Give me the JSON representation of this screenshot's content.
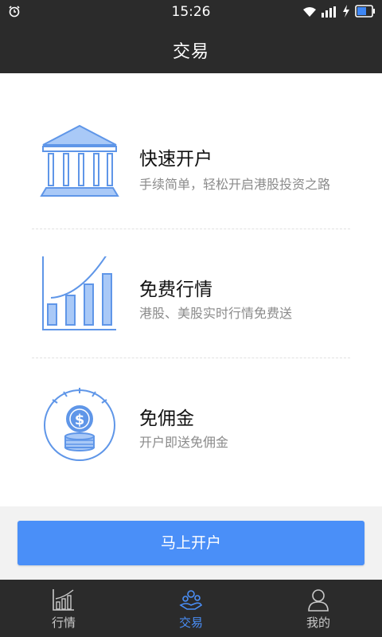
{
  "status_bar": {
    "time": "15:26",
    "icons": [
      "alarm-icon",
      "wifi-icon",
      "signal-icon",
      "charging-icon",
      "battery-icon"
    ]
  },
  "header": {
    "title": "交易"
  },
  "features": [
    {
      "icon": "bank-building-icon",
      "title": "快速开户",
      "subtitle": "手续简单，轻松开启港股投资之路"
    },
    {
      "icon": "bar-chart-growth-icon",
      "title": "免费行情",
      "subtitle": "港股、美股实时行情免费送"
    },
    {
      "icon": "dollar-coins-icon",
      "title": "免佣金",
      "subtitle": "开户即送免佣金"
    }
  ],
  "cta": {
    "label": "马上开户"
  },
  "tabs": [
    {
      "icon": "market-chart-icon",
      "label": "行情",
      "active": false
    },
    {
      "icon": "trade-icon",
      "label": "交易",
      "active": true
    },
    {
      "icon": "profile-icon",
      "label": "我的",
      "active": false
    }
  ],
  "colors": {
    "bar_bg": "#2b2b2b",
    "accent": "#4a8ff8",
    "icon_stroke": "#5f96e8",
    "icon_fill": "#a9c9f7",
    "desc_text": "#8b8b8b"
  }
}
